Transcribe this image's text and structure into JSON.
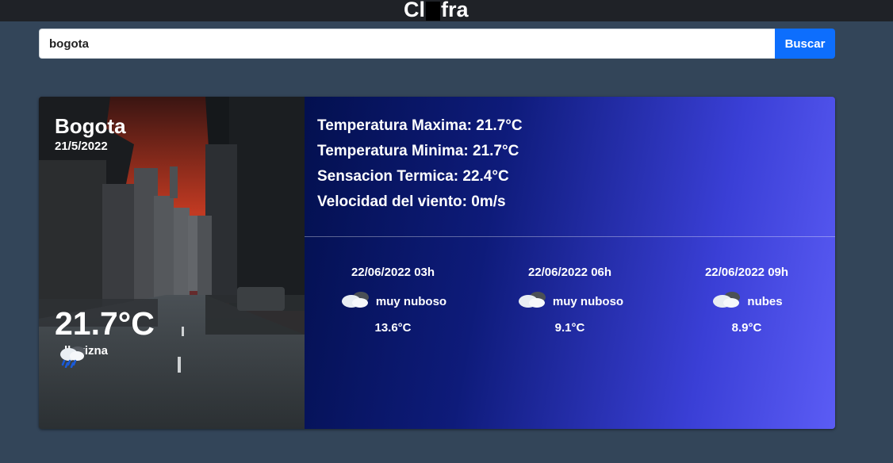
{
  "header": {
    "brand_left": "Cl",
    "brand_mid": "in",
    "brand_right": "fra"
  },
  "search": {
    "value": "bogota",
    "button_label": "Buscar"
  },
  "current": {
    "city": "Bogota",
    "date": "21/5/2022",
    "temperature": "21.7°C",
    "condition": "llovizna",
    "condition_icon": "rain-cloud-icon"
  },
  "details": {
    "temp_max": "Temperatura Maxima: 21.7°C",
    "temp_min": "Temperatura Minima: 21.7°C",
    "feels_like": "Sensacion Termica: 22.4°C",
    "wind": "Velocidad del viento: 0m/s"
  },
  "forecast": [
    {
      "datetime": "22/06/2022 03h",
      "condition": "muy nuboso",
      "icon": "cloud-icon",
      "temperature": "13.6°C"
    },
    {
      "datetime": "22/06/2022 06h",
      "condition": "muy nuboso",
      "icon": "cloud-icon",
      "temperature": "9.1°C"
    },
    {
      "datetime": "22/06/2022 09h",
      "condition": "nubes",
      "icon": "cloud-icon",
      "temperature": "8.9°C"
    }
  ],
  "colors": {
    "page_bg": "#334559",
    "topbar_bg": "#1f2227",
    "button_bg": "#0d6efd",
    "gradient_start": "#03104f",
    "gradient_end": "#5b5cf5"
  }
}
